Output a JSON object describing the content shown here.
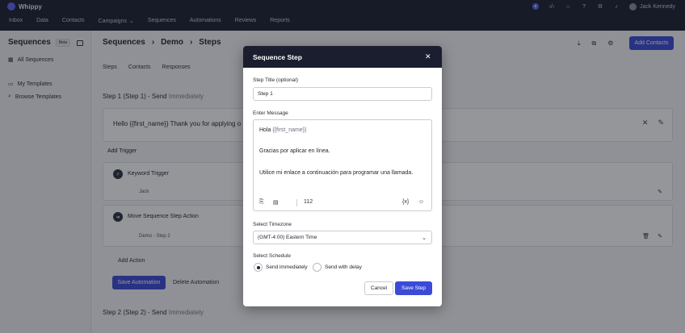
{
  "app": {
    "name": "Whippy"
  },
  "nav": {
    "items": [
      "Inbox",
      "Data",
      "Contacts",
      "Campaigns",
      "Sequences",
      "Automations",
      "Reviews",
      "Reports"
    ]
  },
  "user": {
    "name": "Jack Kennedy"
  },
  "sidebar": {
    "title": "Sequences",
    "badge": "Beta",
    "items": [
      {
        "label": "All Sequences"
      },
      {
        "label": "My Templates"
      },
      {
        "label": "Browse Templates"
      }
    ]
  },
  "header": {
    "crumbs": [
      "Sequences",
      "Demo",
      "Steps"
    ],
    "add_contacts": "Add Contacts",
    "tabs": [
      "Steps",
      "Contacts",
      "Responses"
    ]
  },
  "steps": {
    "step1_prefix": "Step 1 (Step 1) - Send",
    "step1_timing": "Immediately",
    "message_preview": "Hello {{first_name}} Thank you for applying o",
    "add_trigger": "Add Trigger",
    "keyword_trigger": "Keyword Trigger",
    "keyword_value": "Jack",
    "move_action": "Move Sequence Step Action",
    "move_value": "Demo - Step 2",
    "add_action": "Add Action",
    "save_automation": "Save Automation",
    "delete_automation": "Delete Automation",
    "step2_prefix": "Step 2 (Step 2) - Send",
    "step2_timing": "Immediately"
  },
  "modal": {
    "title": "Sequence Step",
    "step_title_label": "Step Title (optional)",
    "step_title_value": "Step 1",
    "message_label": "Enter Message",
    "message_line1_text": "Hola",
    "message_line1_token": "{{first_name}}",
    "message_line2": "Gracias por aplicar en línea.",
    "message_line3": "Utilice mi enlace a continuación para programar una llamada.",
    "char_count": "112",
    "timezone_label": "Select Timezone",
    "timezone_value": "(GMT-4:00) Eastern Time",
    "schedule_label": "Select Schedule",
    "option_immediately": "Send immediately",
    "option_delay": "Send with delay",
    "cancel": "Cancel",
    "save": "Save Step"
  },
  "colors": {
    "primary": "#3b4bd8",
    "nav_bg": "#1b1e2e"
  }
}
